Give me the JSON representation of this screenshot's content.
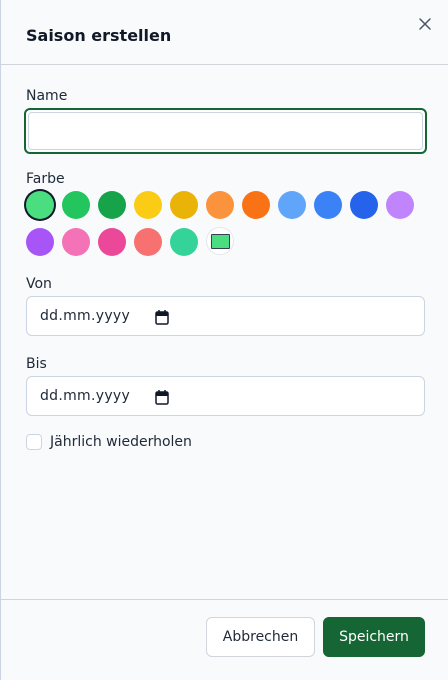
{
  "dialog": {
    "title": "Saison erstellen",
    "close_icon": "close-icon"
  },
  "form": {
    "name": {
      "label": "Name",
      "value": "",
      "placeholder": ""
    },
    "color": {
      "label": "Farbe",
      "swatches": [
        "#4ade80",
        "#22c55e",
        "#16a34a",
        "#facc15",
        "#eab308",
        "#fb923c",
        "#f97316",
        "#60a5fa",
        "#3b82f6",
        "#2563eb",
        "#c084fc",
        "#a855f7",
        "#f472b6",
        "#ec4899",
        "#f87171",
        "#34d399"
      ],
      "selected": "#4ade80",
      "custom_value": "#4ade80"
    },
    "from": {
      "label": "Von",
      "value": "dd.mm.yyyy",
      "icon": "calendar-icon"
    },
    "to": {
      "label": "Bis",
      "value": "dd.mm.yyyy",
      "icon": "calendar-icon"
    },
    "repeat": {
      "label": "Jährlich wiederholen",
      "checked": false
    }
  },
  "footer": {
    "cancel_label": "Abbrechen",
    "save_label": "Speichern"
  },
  "colors": {
    "primary": "#166534",
    "border": "#cbd5e1",
    "background": "#f8fafc"
  }
}
